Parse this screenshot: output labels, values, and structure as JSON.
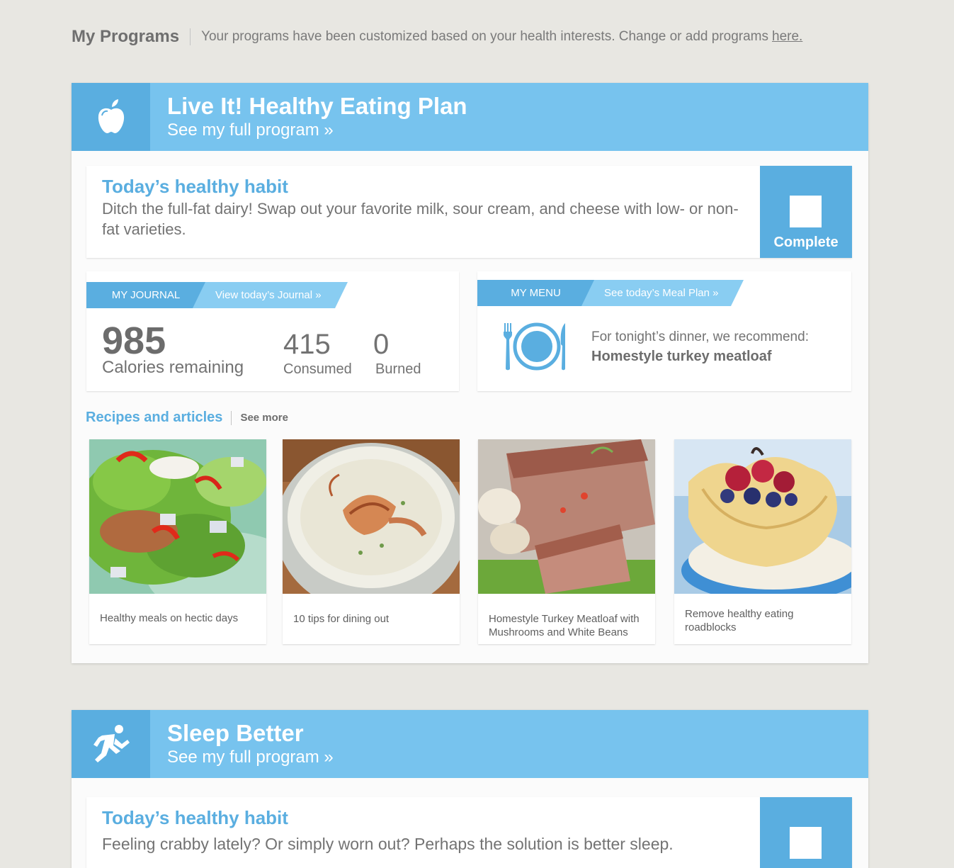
{
  "top": {
    "title": "My Programs",
    "description": "Your programs have been customized based on your health interests. Change or add programs",
    "link": "here."
  },
  "programs": [
    {
      "title": "Live It! Healthy Eating Plan",
      "link": "See my full program »",
      "icon": "apple-icon",
      "habit": {
        "title": "Today’s healthy habit",
        "text": "Ditch the full-fat dairy! Swap out your favorite milk, sour cream, and cheese with low- or non-fat varieties.",
        "complete": "Complete"
      },
      "journal": {
        "tab": "MY JOURNAL",
        "link": "View today’s Journal »",
        "calories_remaining": "985",
        "calories_remaining_label": "Calories remaining",
        "consumed": "415",
        "consumed_label": "Consumed",
        "burned": "0",
        "burned_label": "Burned"
      },
      "menu": {
        "tab": "MY MENU",
        "link": "See today’s Meal Plan »",
        "text": "For tonight’s dinner, we recommend:",
        "dish": "Homestyle turkey meatloaf"
      },
      "recipes": {
        "title": "Recipes and articles",
        "more": "See more",
        "items": [
          {
            "caption": "Healthy meals on hectic days"
          },
          {
            "caption": "10 tips for dining out"
          },
          {
            "caption": "Homestyle Turkey Meatloaf with Mushrooms and White Beans"
          },
          {
            "caption": "Remove healthy eating roadblocks"
          }
        ]
      }
    },
    {
      "title": "Sleep Better",
      "link": "See my full program »",
      "icon": "running-person-icon",
      "habit": {
        "title": "Today’s healthy habit",
        "text": "Feeling crabby lately? Or simply worn out? Perhaps the solution is better sleep."
      }
    }
  ],
  "colors": {
    "background": "#e8e7e2",
    "header": "#77c3ee",
    "accent": "#5aaee0",
    "ribbon_light": "#89cdf2"
  }
}
